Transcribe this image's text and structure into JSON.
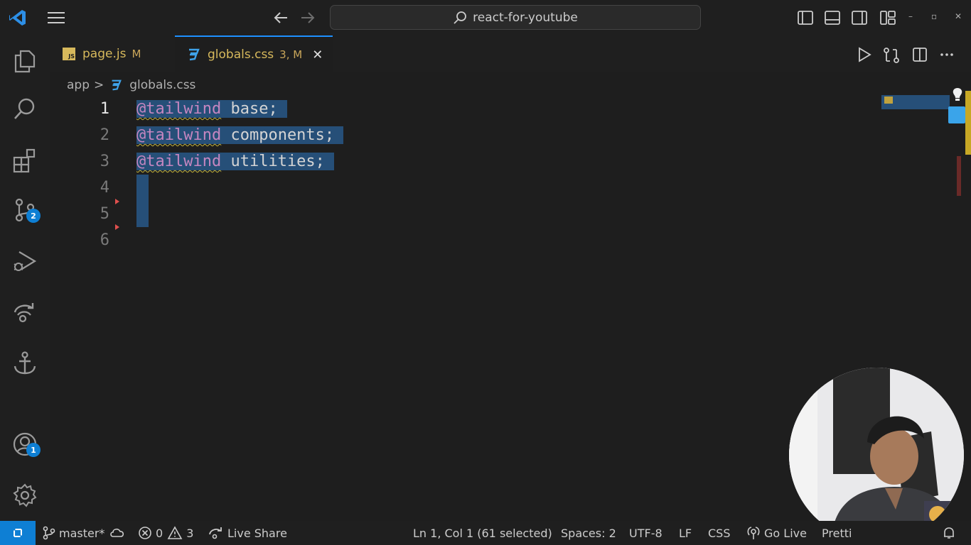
{
  "titlebar": {
    "search_text": "react-for-youtube",
    "window_controls": [
      "–",
      "▫",
      "✕"
    ]
  },
  "activity_bar": {
    "items": [
      {
        "name": "explorer",
        "icon": "files-icon"
      },
      {
        "name": "search",
        "icon": "search-icon"
      },
      {
        "name": "extensions",
        "icon": "extensions-icon"
      },
      {
        "name": "source-control",
        "icon": "source-control-icon",
        "badge": "2"
      },
      {
        "name": "run-debug",
        "icon": "run-debug-icon"
      },
      {
        "name": "live-share",
        "icon": "live-share-icon"
      },
      {
        "name": "anchor",
        "icon": "anchor-icon"
      },
      {
        "name": "accounts",
        "icon": "account-icon",
        "badge": "1"
      },
      {
        "name": "manage",
        "icon": "gear-icon"
      }
    ]
  },
  "tabs": [
    {
      "label": "page.js",
      "status": "M",
      "icon": "js-file-icon",
      "active": false,
      "file_icon_text": "JS"
    },
    {
      "label": "globals.css",
      "status": "3, M",
      "icon": "css-file-icon",
      "active": true,
      "close": "✕"
    }
  ],
  "breadcrumb": {
    "folder": "app",
    "separator": ">",
    "file": "globals.css"
  },
  "editor": {
    "line_numbers": [
      "1",
      "2",
      "3",
      "4",
      "5",
      "6"
    ],
    "lines": [
      {
        "directive": "@tailwind",
        "value": "base;"
      },
      {
        "directive": "@tailwind",
        "value": "components;"
      },
      {
        "directive": "@tailwind",
        "value": "utilities;"
      }
    ],
    "selection_color": "#264f78",
    "directive_color": "#c586c0"
  },
  "statusbar": {
    "branch": "master*",
    "errors": "0",
    "warnings": "3",
    "live_share": "Live Share",
    "cursor": "Ln 1, Col 1 (61 selected)",
    "spaces": "Spaces: 2",
    "encoding": "UTF-8",
    "eol": "LF",
    "language": "CSS",
    "go_live": "Go Live",
    "prettier": "Pretti",
    "accent": "#0e7fd4"
  }
}
